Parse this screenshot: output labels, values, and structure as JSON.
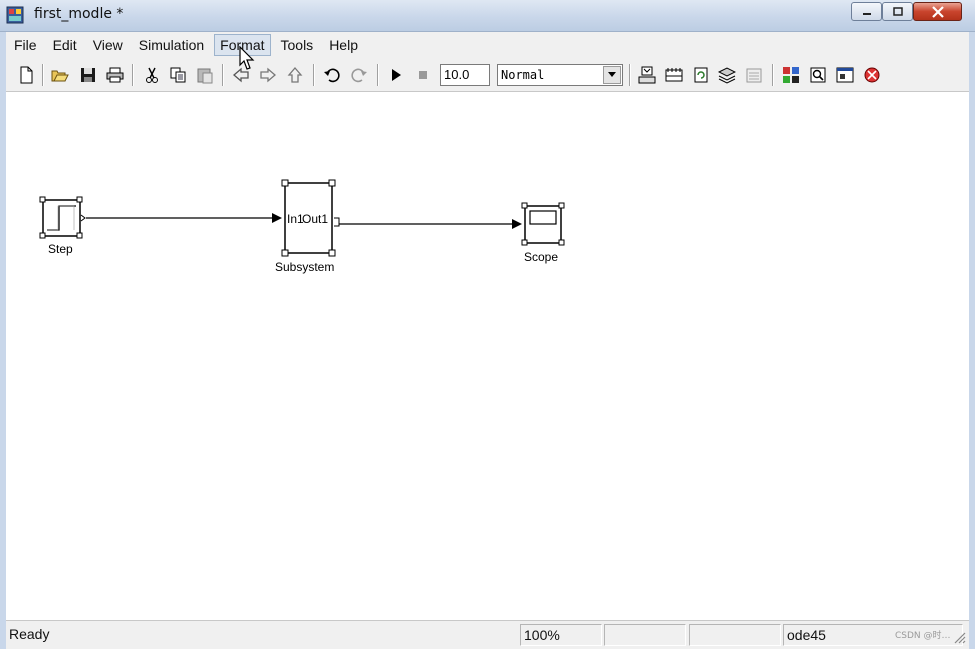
{
  "window": {
    "title": "first_modle *"
  },
  "menubar": {
    "items": [
      {
        "label": "File"
      },
      {
        "label": "Edit"
      },
      {
        "label": "View"
      },
      {
        "label": "Simulation"
      },
      {
        "label": "Format",
        "active": true
      },
      {
        "label": "Tools"
      },
      {
        "label": "Help"
      }
    ]
  },
  "toolbar": {
    "stop_time": "10.0",
    "sim_mode": "Normal",
    "icons": [
      "new-model-icon",
      "open-icon",
      "save-icon",
      "print-icon",
      "cut-icon",
      "copy-icon",
      "paste-icon",
      "back-icon",
      "forward-icon",
      "up-icon",
      "undo-icon",
      "redo-icon",
      "start-simulation-icon",
      "stop-simulation-icon",
      "update-diagram-icon",
      "build-icon",
      "refresh-icon",
      "library-browser-icon",
      "model-explorer-icon",
      "debugger-icon"
    ]
  },
  "diagram": {
    "blocks": {
      "step": {
        "label": "Step"
      },
      "subsystem": {
        "label": "Subsystem",
        "in_port": "In1",
        "out_port": "Out1"
      },
      "scope": {
        "label": "Scope"
      }
    }
  },
  "statusbar": {
    "status": "Ready",
    "zoom": "100%",
    "solver": "ode45"
  },
  "watermark": "CSDN @时…"
}
